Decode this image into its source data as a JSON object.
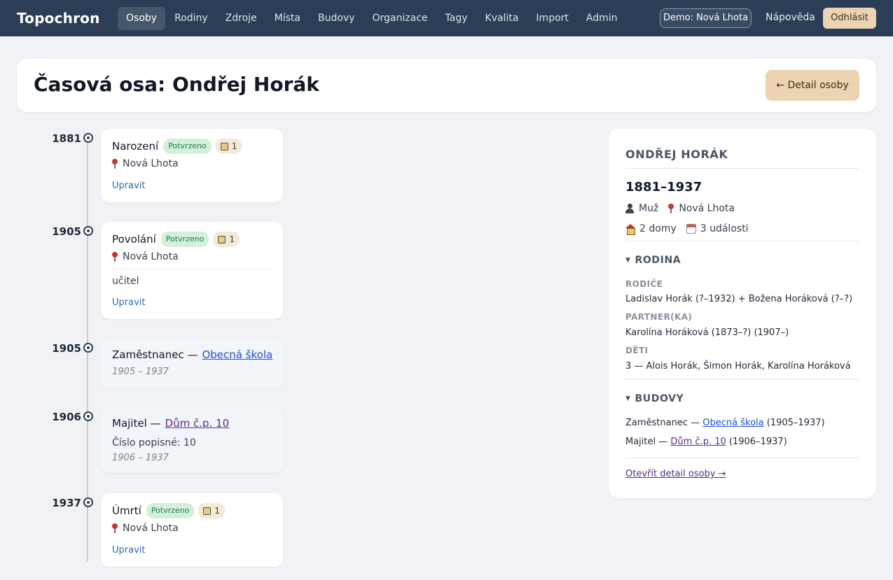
{
  "app": {
    "brand": "Topochron"
  },
  "nav": {
    "items": [
      {
        "label": "Osoby",
        "active": true
      },
      {
        "label": "Rodiny"
      },
      {
        "label": "Zdroje"
      },
      {
        "label": "Místa"
      },
      {
        "label": "Budovy"
      },
      {
        "label": "Organizace"
      },
      {
        "label": "Tagy"
      },
      {
        "label": "Kvalita"
      },
      {
        "label": "Import"
      },
      {
        "label": "Admin"
      }
    ],
    "demo_badge": "Demo: Nová Lhota",
    "help": "Nápověda",
    "logout": "Odhlásit"
  },
  "header": {
    "title": "Časová osa: Ondřej Horák",
    "back_button": "← Detail osoby"
  },
  "timeline": [
    {
      "year": "1881",
      "title": "Narození",
      "status": "Potvrzeno",
      "sources": "1",
      "place": "Nová Lhota",
      "edit": "Upravit"
    },
    {
      "year": "1905",
      "title": "Povolání",
      "status": "Potvrzeno",
      "sources": "1",
      "place": "Nová Lhota",
      "note": "učitel",
      "edit": "Upravit"
    },
    {
      "year": "1905",
      "title": "Zaměstnanec —",
      "link": "Obecná škola",
      "range": "1905 – 1937"
    },
    {
      "year": "1906",
      "title": "Majitel —",
      "link": "Dům č.p. 10",
      "detail": "Číslo popisné: 10",
      "range": "1906 – 1937"
    },
    {
      "year": "1937",
      "title": "Úmrtí",
      "status": "Potvrzeno",
      "sources": "1",
      "place": "Nová Lhota",
      "edit": "Upravit"
    }
  ],
  "side": {
    "name": "ONDŘEJ HORÁK",
    "years": "1881–1937",
    "sex": "Muž",
    "place": "Nová Lhota",
    "houses": "2 domy",
    "events": "3 události",
    "family_title": "RODINA",
    "parents_label": "RODIČE",
    "parents": "Ladislav Horák (?–1932) + Božena Horáková (?–?)",
    "partner_label": "PARTNER(KA)",
    "partner": "Karolína Horáková (1873–?) (1907–)",
    "children_label": "DĚTI",
    "children": "3 — Alois Horák, Šimon Horák, Karolína Horáková",
    "buildings_title": "BUDOVY",
    "buildings": [
      {
        "role": "Zaměstnanec —",
        "link": "Obecná škola",
        "range": "(1905–1937)"
      },
      {
        "role": "Majitel —",
        "link": "Dům č.p. 10",
        "range": "(1906–1937)"
      }
    ],
    "open_detail": "Otevřít detail osoby →"
  },
  "icons": {
    "place": "pin-icon",
    "source": "book-icon",
    "sex": "person-icon",
    "houses": "house-icon",
    "events": "calendar-icon"
  }
}
